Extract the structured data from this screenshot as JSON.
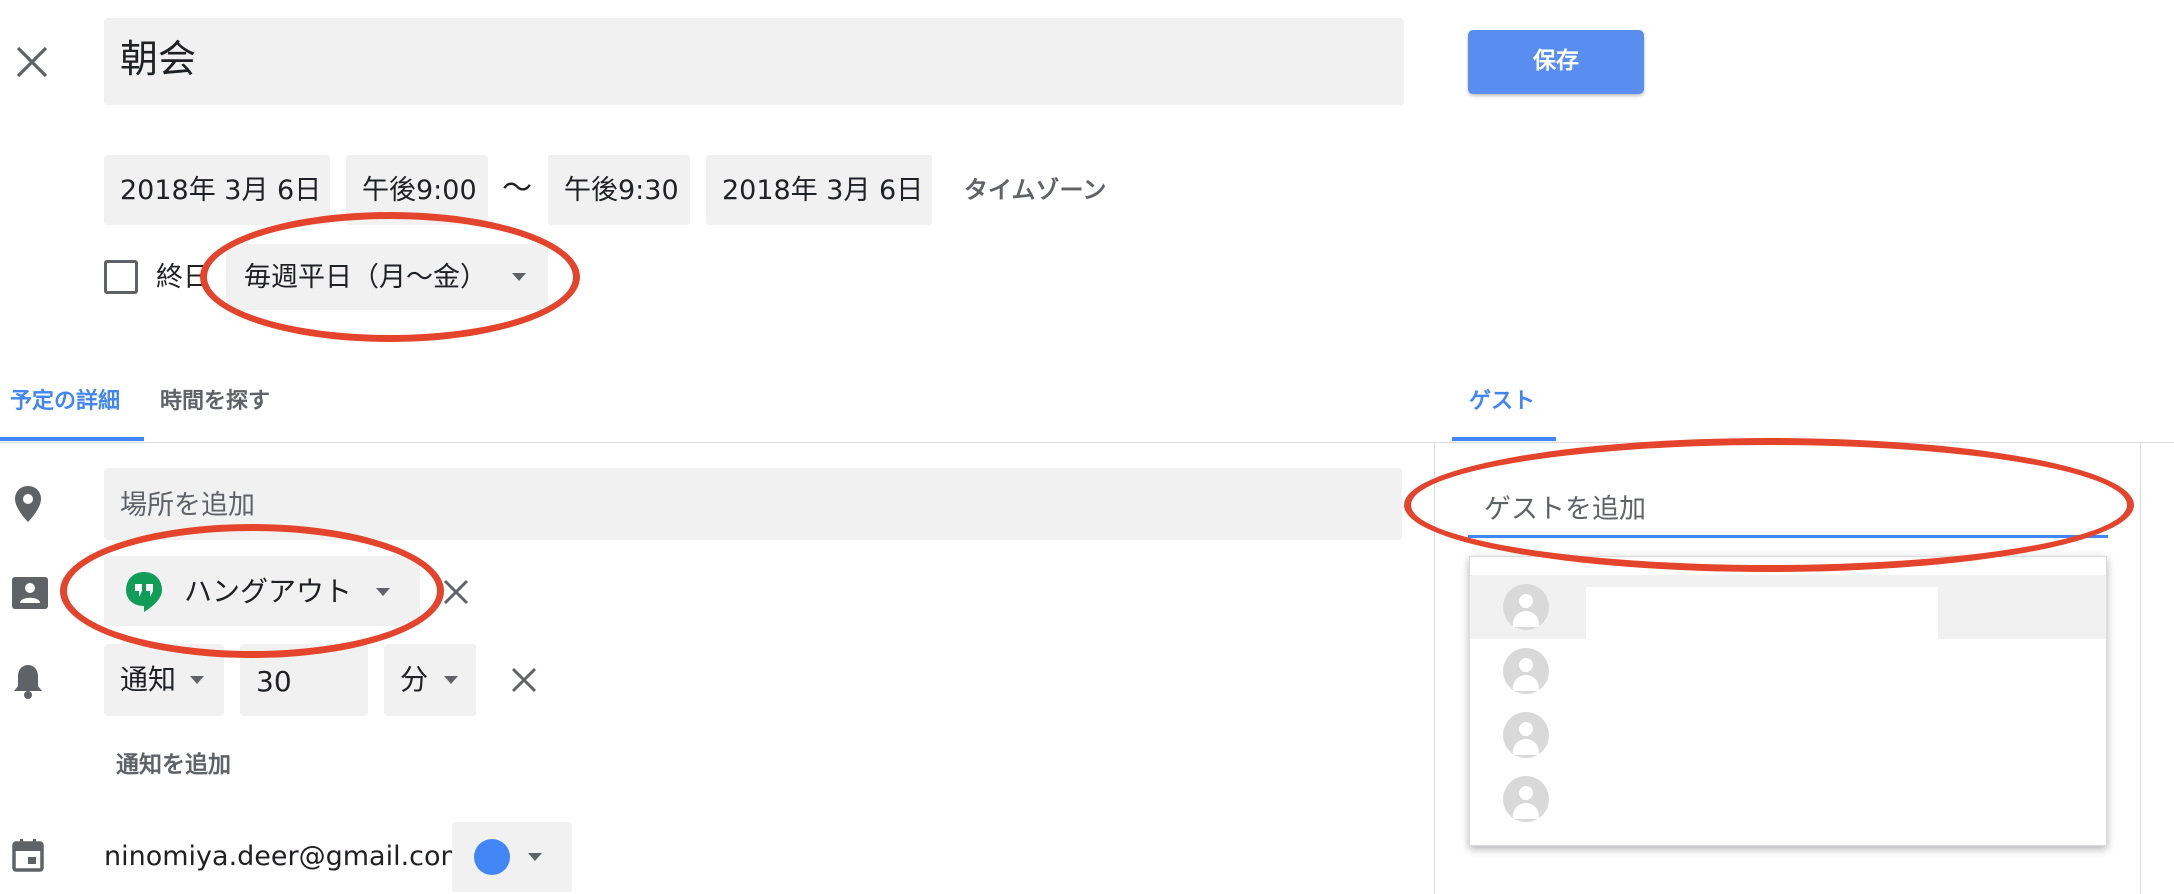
{
  "header": {
    "title": "朝会",
    "save_label": "保存"
  },
  "datetime": {
    "start_date": "2018年 3月 6日",
    "start_time": "午後9:00",
    "separator": "〜",
    "end_time": "午後9:30",
    "end_date": "2018年 3月 6日",
    "timezone_label": "タイムゾーン"
  },
  "allday": {
    "label": "終日",
    "checked": false
  },
  "recurrence": {
    "selected": "毎週平日（月〜金）"
  },
  "tabs": {
    "details": "予定の詳細",
    "find_time": "時間を探す",
    "guests": "ゲスト",
    "active": "予定の詳細"
  },
  "details": {
    "location_placeholder": "場所を追加",
    "conference": "ハングアウト",
    "notification": {
      "type": "通知",
      "value": "30",
      "unit": "分"
    },
    "add_notification": "通知を追加",
    "calendar_owner": "ninomiya.deer@gmail.com",
    "calendar_color": "#4285f4"
  },
  "guests": {
    "input_placeholder": "ゲストを追加",
    "suggestions": [
      "",
      "",
      "",
      ""
    ]
  },
  "colors": {
    "accent": "#4285f4",
    "save_button": "#5a8df0",
    "annotation": "#e3442b",
    "hangouts_green": "#0f9d58"
  },
  "icons": {
    "close": "close-icon",
    "location": "location-pin-icon",
    "conference": "conference-icon",
    "notification": "bell-icon",
    "calendar": "calendar-icon",
    "hangouts": "hangouts-icon",
    "avatar": "person-avatar-icon"
  }
}
